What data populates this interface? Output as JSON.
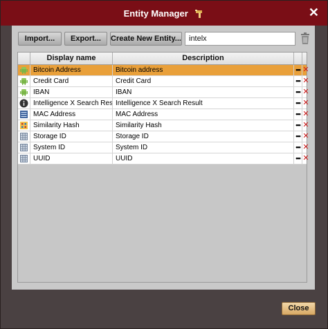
{
  "window": {
    "title": "Entity Manager",
    "close_glyph": "✕"
  },
  "toolbar": {
    "import_label": "Import...",
    "export_label": "Export...",
    "create_label": "Create New Entity...",
    "search_value": "intelx"
  },
  "table": {
    "headers": [
      "",
      "Display name",
      "Description"
    ],
    "rows": [
      {
        "icon": "android-icon",
        "name": "Bitcoin Address",
        "description": "Bitcoin address",
        "selected": true
      },
      {
        "icon": "android-icon",
        "name": "Credit Card",
        "description": "Credit Card",
        "selected": false
      },
      {
        "icon": "android-icon",
        "name": "IBAN",
        "description": "IBAN",
        "selected": false
      },
      {
        "icon": "info-icon",
        "name": "Intelligence X Search Result",
        "description": "Intelligence X Search Result",
        "selected": false
      },
      {
        "icon": "network-card-icon",
        "name": "MAC Address",
        "description": "MAC Address",
        "selected": false
      },
      {
        "icon": "hash-icon",
        "name": "Similarity Hash",
        "description": "Similarity Hash",
        "selected": false
      },
      {
        "icon": "grid-icon",
        "name": "Storage ID",
        "description": "Storage ID",
        "selected": false
      },
      {
        "icon": "grid-icon",
        "name": "System ID",
        "description": "System ID",
        "selected": false
      },
      {
        "icon": "grid-icon",
        "name": "UUID",
        "description": "UUID",
        "selected": false
      }
    ],
    "more_glyph": "•••",
    "delete_glyph": "✕"
  },
  "footer": {
    "close_label": "Close"
  },
  "colors": {
    "titlebar": "#7a0e16",
    "selected_row": "#e9a03a",
    "delete": "#cc1a1a"
  }
}
